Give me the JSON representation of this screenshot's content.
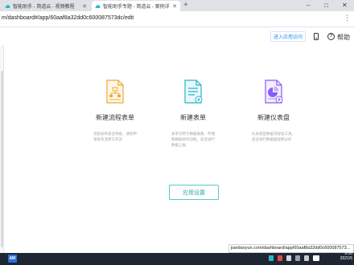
{
  "browser": {
    "tabs": [
      {
        "title": "智能助手 - 简道云 - 视频教程",
        "active": false
      },
      {
        "title": "智能助手专题 - 简道云 - 案例详情",
        "active": true
      }
    ],
    "new_tab": "+",
    "window_controls": [
      "–",
      "□",
      "✕"
    ],
    "url": "m/dashboard#/app/60aaf8a32dd0c600087573dc/edit",
    "status_url": "jiandaoyun.com/dashboard/app/60aaf8a32dd0c600087573..."
  },
  "header": {
    "access_button": "进入应用访问",
    "help_icon_glyph": "?",
    "help_label": "帮助"
  },
  "cards": [
    {
      "icon": "workflow-form-icon",
      "title": "新建流程表单",
      "description": "流程表单适合审批、请假申请等有流转工作流",
      "color": "#f0a732"
    },
    {
      "icon": "form-icon",
      "title": "新建表单",
      "description": "表单可用于数据收集、存储和数据协作功能，适合进行数据上报",
      "color": "#2bb5c9"
    },
    {
      "icon": "dashboard-icon",
      "title": "新建仪表盘",
      "description": "仪表盘是数据可视化工具，适合进行数据展现和分析",
      "color": "#8b5cf6"
    }
  ],
  "app_settings_button": "应用设置",
  "taskbar": {
    "start_label": "AW",
    "clock_time": "9:06",
    "clock_date": "2021/5"
  },
  "colors": {
    "accent": "#2fa4b0",
    "link": "#1f8ceb"
  }
}
